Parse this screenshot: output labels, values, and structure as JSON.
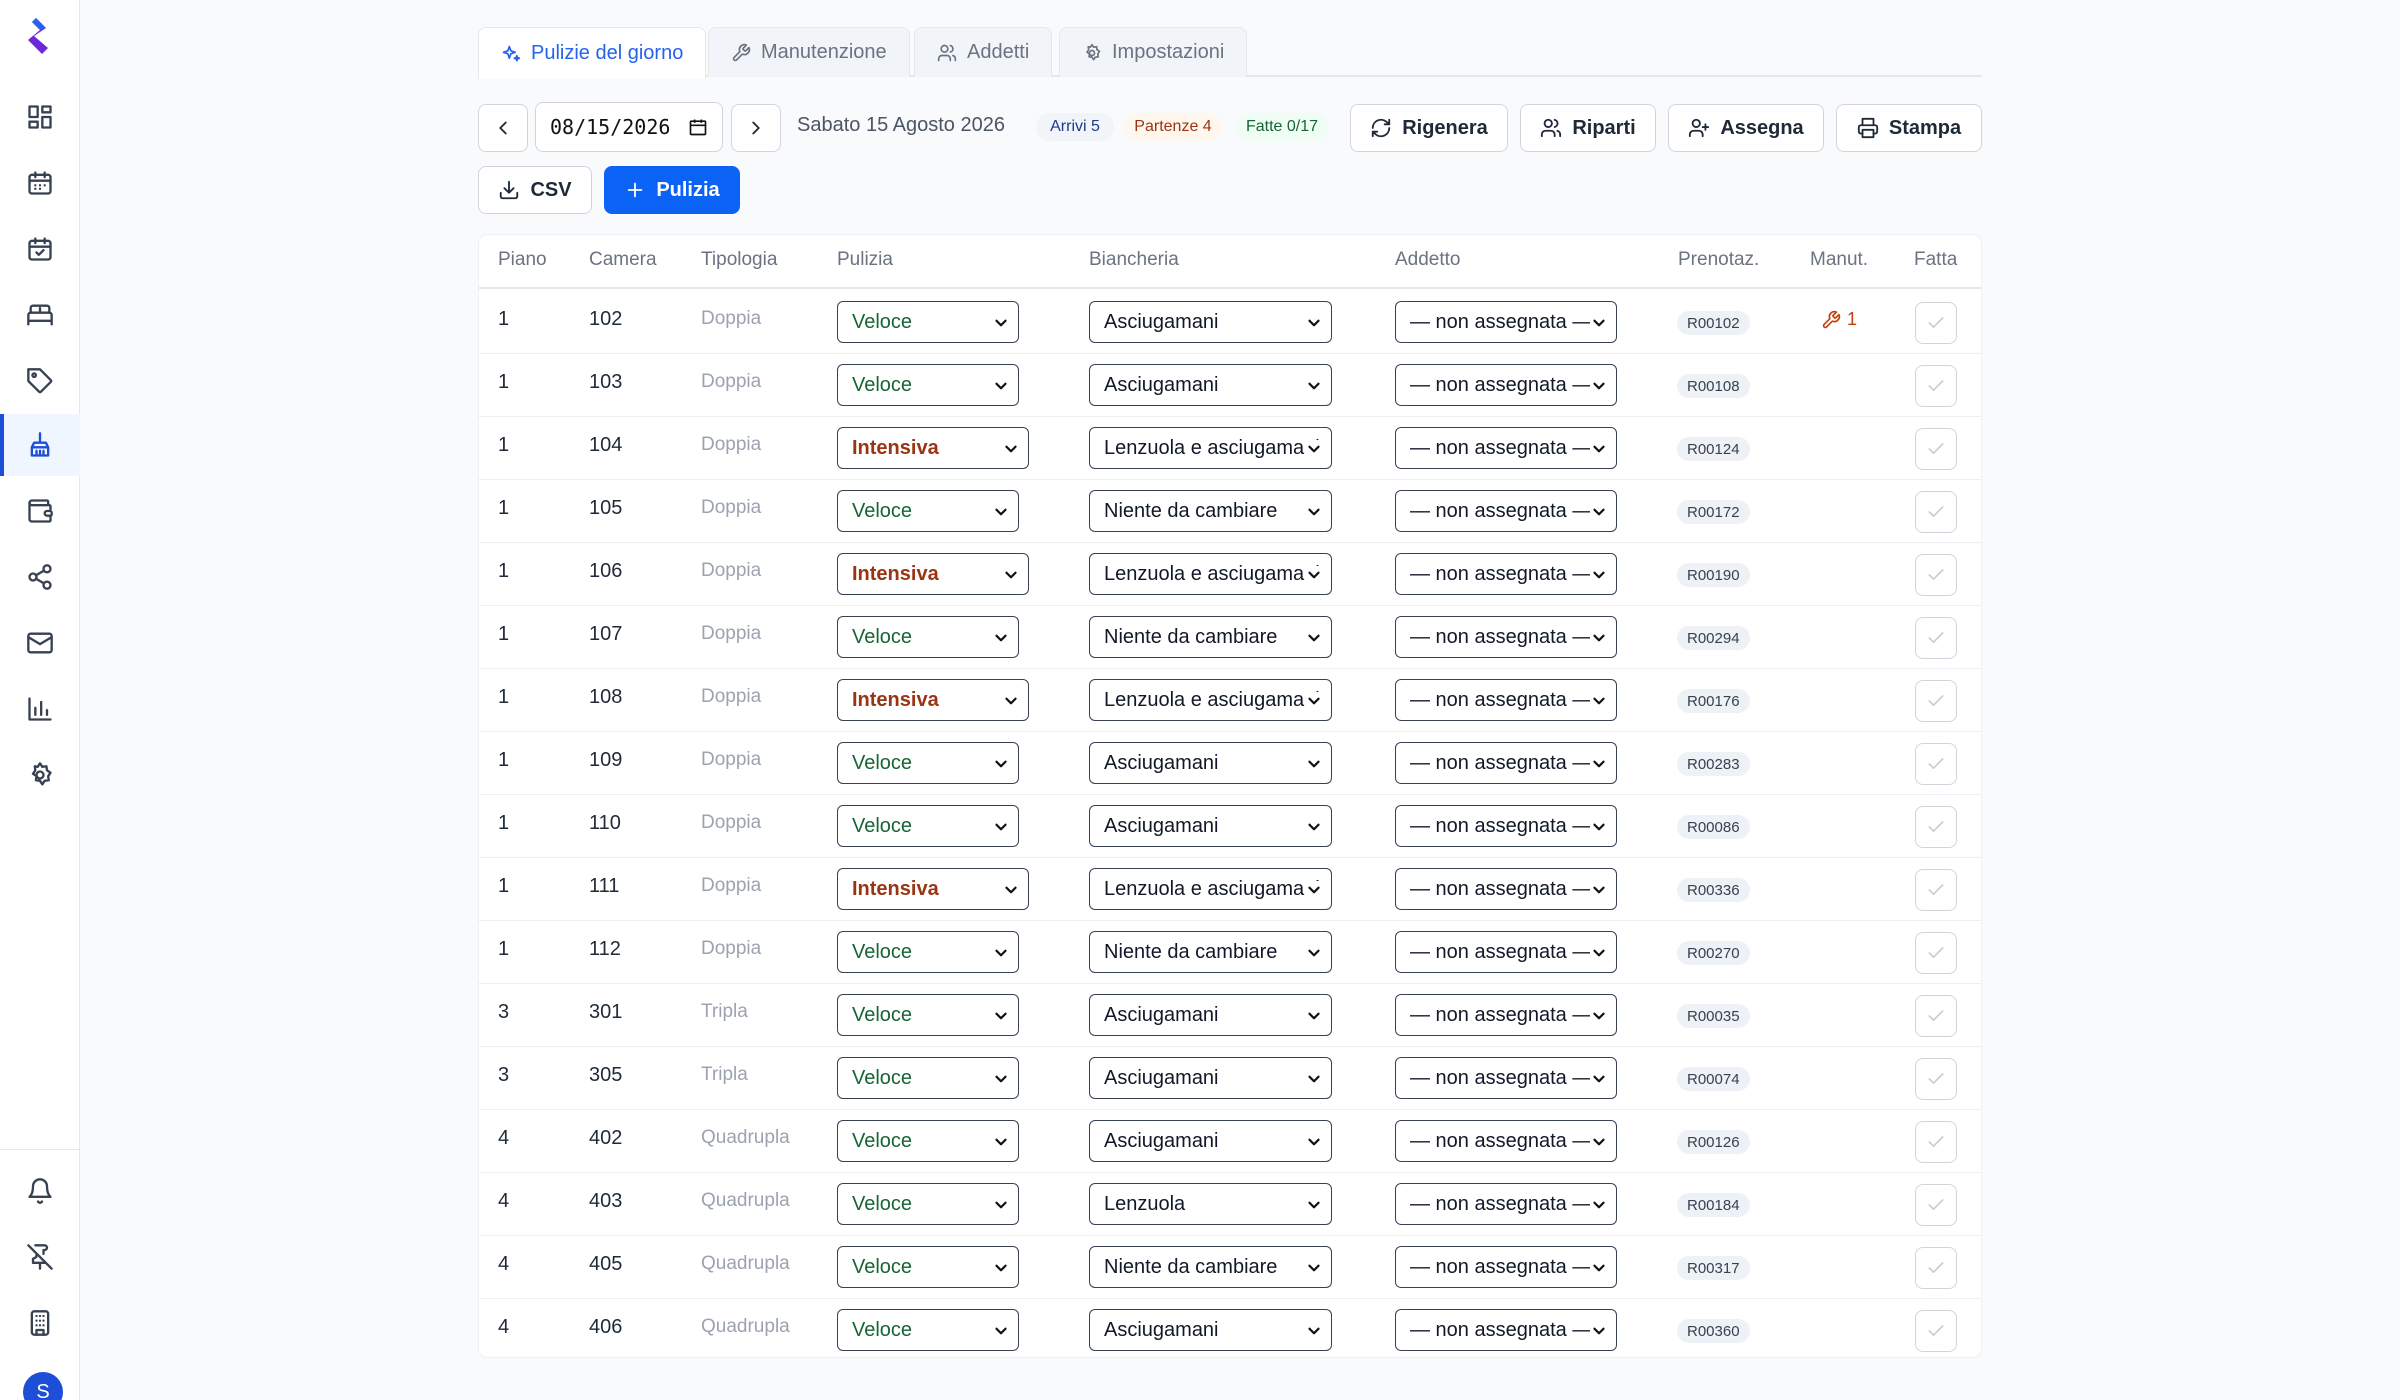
{
  "sidebar": {
    "avatar_initial": "S",
    "items": [
      {
        "icon": "dashboard-icon"
      },
      {
        "icon": "calendar-icon"
      },
      {
        "icon": "calendar-check-icon"
      },
      {
        "icon": "bed-icon"
      },
      {
        "icon": "tag-icon"
      },
      {
        "icon": "broom-icon",
        "active": true
      },
      {
        "icon": "wallet-icon"
      },
      {
        "icon": "share-icon"
      },
      {
        "icon": "mail-icon"
      },
      {
        "icon": "bar-chart-icon"
      },
      {
        "icon": "settings-icon"
      },
      {
        "icon": "bell-icon"
      },
      {
        "icon": "pin-off-icon"
      },
      {
        "icon": "building-icon"
      }
    ]
  },
  "tabs": [
    {
      "label": "Pulizie del giorno",
      "icon": "sparkles-icon",
      "active": true
    },
    {
      "label": "Manutenzione",
      "icon": "wrench-icon"
    },
    {
      "label": "Addetti",
      "icon": "users-icon"
    },
    {
      "label": "Impostazioni",
      "icon": "gear-icon"
    }
  ],
  "toolbar": {
    "date_value": "08/15/2026",
    "date_label": "Sabato 15 Agosto 2026",
    "arrivi": "Arrivi 5",
    "partenze": "Partenze 4",
    "fatte": "Fatte 0/17",
    "rigenera": "Rigenera",
    "riparti": "Riparti",
    "assegna": "Assegna",
    "stampa": "Stampa",
    "csv": "CSV",
    "pulizia": "Pulizia"
  },
  "colors": {
    "accent": "#0b63f6",
    "veloce": "#166534",
    "intensiva": "#9a3412",
    "maintenance": "#c2410c"
  },
  "table": {
    "headers": {
      "piano": "Piano",
      "camera": "Camera",
      "tipologia": "Tipologia",
      "pulizia": "Pulizia",
      "biancheria": "Biancheria",
      "addetto": "Addetto",
      "prenotaz": "Prenotaz.",
      "manut": "Manut.",
      "fatta": "Fatta"
    },
    "rows": [
      {
        "piano": "1",
        "camera": "102",
        "tipologia": "Doppia",
        "pulizia": "Veloce",
        "biancheria": "Asciugamani",
        "addetto": "— non assegnata —",
        "prenotaz": "R00102",
        "manut": "1"
      },
      {
        "piano": "1",
        "camera": "103",
        "tipologia": "Doppia",
        "pulizia": "Veloce",
        "biancheria": "Asciugamani",
        "addetto": "— non assegnata —",
        "prenotaz": "R00108"
      },
      {
        "piano": "1",
        "camera": "104",
        "tipologia": "Doppia",
        "pulizia": "Intensiva",
        "biancheria": "Lenzuola e asciugamani",
        "addetto": "— non assegnata —",
        "prenotaz": "R00124"
      },
      {
        "piano": "1",
        "camera": "105",
        "tipologia": "Doppia",
        "pulizia": "Veloce",
        "biancheria": "Niente da cambiare",
        "addetto": "— non assegnata —",
        "prenotaz": "R00172"
      },
      {
        "piano": "1",
        "camera": "106",
        "tipologia": "Doppia",
        "pulizia": "Intensiva",
        "biancheria": "Lenzuola e asciugamani",
        "addetto": "— non assegnata —",
        "prenotaz": "R00190"
      },
      {
        "piano": "1",
        "camera": "107",
        "tipologia": "Doppia",
        "pulizia": "Veloce",
        "biancheria": "Niente da cambiare",
        "addetto": "— non assegnata —",
        "prenotaz": "R00294"
      },
      {
        "piano": "1",
        "camera": "108",
        "tipologia": "Doppia",
        "pulizia": "Intensiva",
        "biancheria": "Lenzuola e asciugamani",
        "addetto": "— non assegnata —",
        "prenotaz": "R00176"
      },
      {
        "piano": "1",
        "camera": "109",
        "tipologia": "Doppia",
        "pulizia": "Veloce",
        "biancheria": "Asciugamani",
        "addetto": "— non assegnata —",
        "prenotaz": "R00283"
      },
      {
        "piano": "1",
        "camera": "110",
        "tipologia": "Doppia",
        "pulizia": "Veloce",
        "biancheria": "Asciugamani",
        "addetto": "— non assegnata —",
        "prenotaz": "R00086"
      },
      {
        "piano": "1",
        "camera": "111",
        "tipologia": "Doppia",
        "pulizia": "Intensiva",
        "biancheria": "Lenzuola e asciugamani",
        "addetto": "— non assegnata —",
        "prenotaz": "R00336"
      },
      {
        "piano": "1",
        "camera": "112",
        "tipologia": "Doppia",
        "pulizia": "Veloce",
        "biancheria": "Niente da cambiare",
        "addetto": "— non assegnata —",
        "prenotaz": "R00270"
      },
      {
        "piano": "3",
        "camera": "301",
        "tipologia": "Tripla",
        "pulizia": "Veloce",
        "biancheria": "Asciugamani",
        "addetto": "— non assegnata —",
        "prenotaz": "R00035"
      },
      {
        "piano": "3",
        "camera": "305",
        "tipologia": "Tripla",
        "pulizia": "Veloce",
        "biancheria": "Asciugamani",
        "addetto": "— non assegnata —",
        "prenotaz": "R00074"
      },
      {
        "piano": "4",
        "camera": "402",
        "tipologia": "Quadrupla",
        "pulizia": "Veloce",
        "biancheria": "Asciugamani",
        "addetto": "— non assegnata —",
        "prenotaz": "R00126"
      },
      {
        "piano": "4",
        "camera": "403",
        "tipologia": "Quadrupla",
        "pulizia": "Veloce",
        "biancheria": "Lenzuola",
        "addetto": "— non assegnata —",
        "prenotaz": "R00184"
      },
      {
        "piano": "4",
        "camera": "405",
        "tipologia": "Quadrupla",
        "pulizia": "Veloce",
        "biancheria": "Niente da cambiare",
        "addetto": "— non assegnata —",
        "prenotaz": "R00317"
      },
      {
        "piano": "4",
        "camera": "406",
        "tipologia": "Quadrupla",
        "pulizia": "Veloce",
        "biancheria": "Asciugamani",
        "addetto": "— non assegnata —",
        "prenotaz": "R00360"
      }
    ]
  }
}
